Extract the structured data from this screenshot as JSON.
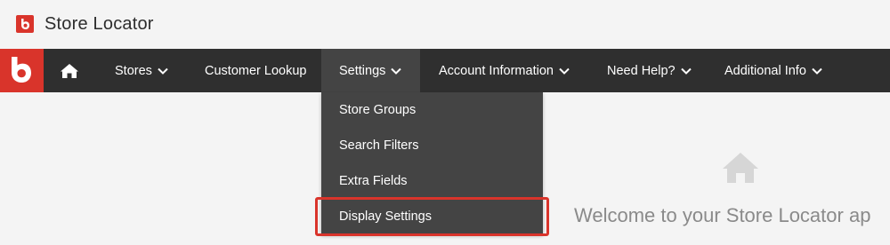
{
  "app": {
    "title": "Store Locator",
    "brand_color": "#d9342b"
  },
  "nav": {
    "home_icon": "home-icon",
    "items": [
      {
        "label": "Stores",
        "has_dropdown": true
      },
      {
        "label": "Customer Lookup",
        "has_dropdown": false
      },
      {
        "label": "Settings",
        "has_dropdown": true,
        "active": true
      },
      {
        "label": "Account Information",
        "has_dropdown": true
      },
      {
        "label": "Need Help?",
        "has_dropdown": true
      },
      {
        "label": "Additional Info",
        "has_dropdown": true
      }
    ]
  },
  "settings_menu": {
    "items": [
      {
        "label": "Store Groups"
      },
      {
        "label": "Search Filters"
      },
      {
        "label": "Extra Fields"
      },
      {
        "label": "Display Settings",
        "highlighted": true
      }
    ]
  },
  "main": {
    "welcome_text": "Welcome to your Store Locator ap",
    "welcome_icon": "home-icon"
  },
  "colors": {
    "navbar_bg": "#2f2f2f",
    "dropdown_bg": "#444444",
    "highlight_border": "#d9342b",
    "page_bg": "#f4f4f4"
  }
}
